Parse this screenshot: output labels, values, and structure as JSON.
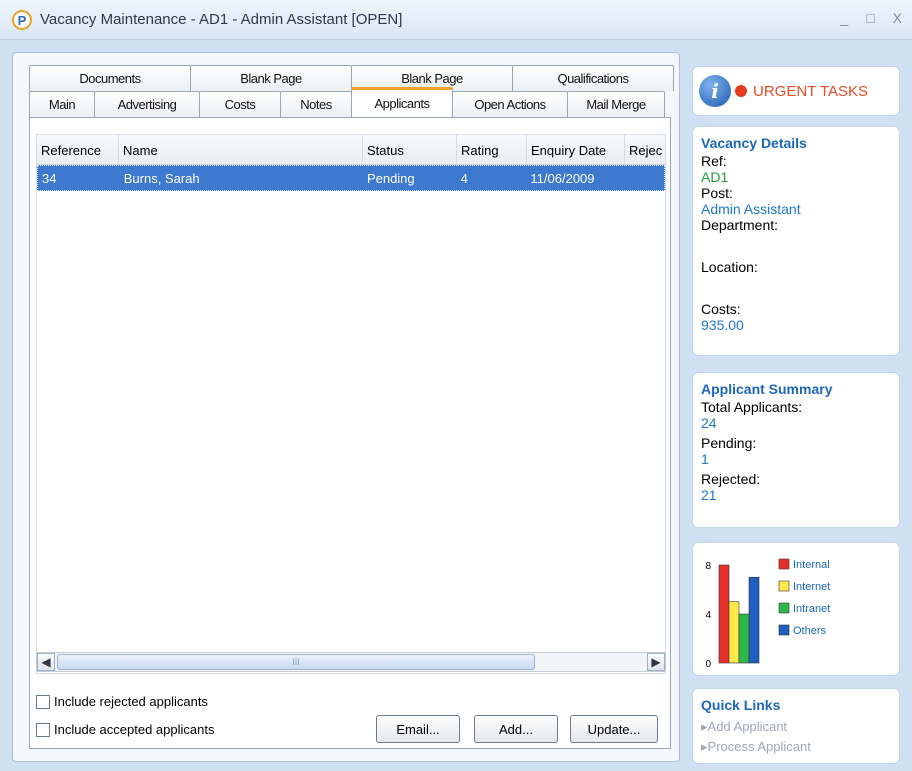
{
  "window": {
    "title": "Vacancy Maintenance - AD1 - Admin Assistant [OPEN]",
    "controls": [
      "_",
      "□",
      "X"
    ]
  },
  "tabs": {
    "row1": [
      "Documents",
      "Blank Page",
      "Blank Page",
      "Qualifications"
    ],
    "row2": [
      "Main",
      "Advertising",
      "Costs",
      "Notes",
      "Applicants",
      "Open Actions",
      "Mail Merge"
    ]
  },
  "grid": {
    "columns": [
      "Reference",
      "Name",
      "Status",
      "Rating",
      "Enquiry Date",
      "Rejec"
    ],
    "rows": [
      [
        "34",
        "Burns, Sarah",
        "Pending",
        "4",
        "11/06/2009",
        ""
      ]
    ]
  },
  "scrollbar": {
    "thumb_grip": "III"
  },
  "options": {
    "include_rejected": "Include rejected applicants",
    "include_accepted": "Include accepted applicants"
  },
  "buttons": {
    "email": "Email...",
    "add": "Add...",
    "update": "Update..."
  },
  "urgent": {
    "label": "URGENT TASKS"
  },
  "vacancy_details": {
    "title": "Vacancy Details",
    "ref_label": "Ref:",
    "ref": "AD1",
    "post_label": "Post:",
    "post": "Admin Assistant",
    "department_label": "Department:",
    "location_label": "Location:",
    "costs_label": "Costs:",
    "costs": "935.00"
  },
  "applicant_summary": {
    "title": "Applicant Summary",
    "total_label": "Total Applicants:",
    "total": "24",
    "pending_label": "Pending:",
    "pending": "1",
    "rejected_label": "Rejected:",
    "rejected": "21"
  },
  "quick_links": {
    "title": "Quick Links",
    "items": [
      "Add Applicant",
      "Process Applicant"
    ]
  },
  "chart_data": {
    "type": "bar",
    "categories": [
      "Internal",
      "Internet",
      "Intranet",
      "Others"
    ],
    "values": [
      8,
      5,
      4,
      7
    ],
    "colors": [
      "#e8302a",
      "#ffe94a",
      "#2fb84a",
      "#1e5fc0"
    ],
    "ylim": [
      0,
      8
    ],
    "yticks": [
      "8",
      "4",
      "0"
    ]
  }
}
